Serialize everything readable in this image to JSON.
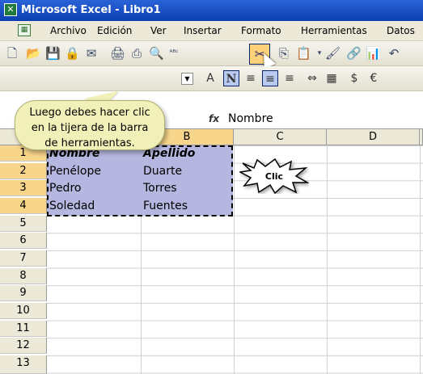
{
  "window": {
    "title": "Microsoft Excel - Libro1",
    "app_icon": "excel-icon"
  },
  "menu": {
    "items": [
      {
        "label": "Archivo",
        "accel": "A"
      },
      {
        "label": "Edición",
        "accel": "E"
      },
      {
        "label": "Ver",
        "accel": "V"
      },
      {
        "label": "Insertar",
        "accel": "I"
      },
      {
        "label": "Formato",
        "accel": "F"
      },
      {
        "label": "Herramientas",
        "accel": "H"
      },
      {
        "label": "Datos",
        "accel": "D"
      }
    ]
  },
  "formula_bar": {
    "fx_label": "fx",
    "value": "Nombre"
  },
  "columns": [
    "B",
    "C",
    "D"
  ],
  "rows": [
    "1",
    "2",
    "3",
    "4",
    "5",
    "6",
    "7",
    "8",
    "9",
    "10",
    "11",
    "12",
    "13"
  ],
  "cells": [
    {
      "a": "Nombre",
      "b": "Apellido"
    },
    {
      "a": "Penélope",
      "b": "Duarte"
    },
    {
      "a": "Pedro",
      "b": "Torres"
    },
    {
      "a": "Soledad",
      "b": "Fuentes"
    }
  ],
  "tooltip": {
    "line1": "Luego debes hacer clic",
    "line2": "en la tijera de la barra",
    "line3": "de herramientas."
  },
  "callout": {
    "label": "Clic"
  },
  "colors": {
    "selection": "#b6b7e0",
    "header_selected": "#f7d58a",
    "title_bar": "#0b3fb0"
  }
}
